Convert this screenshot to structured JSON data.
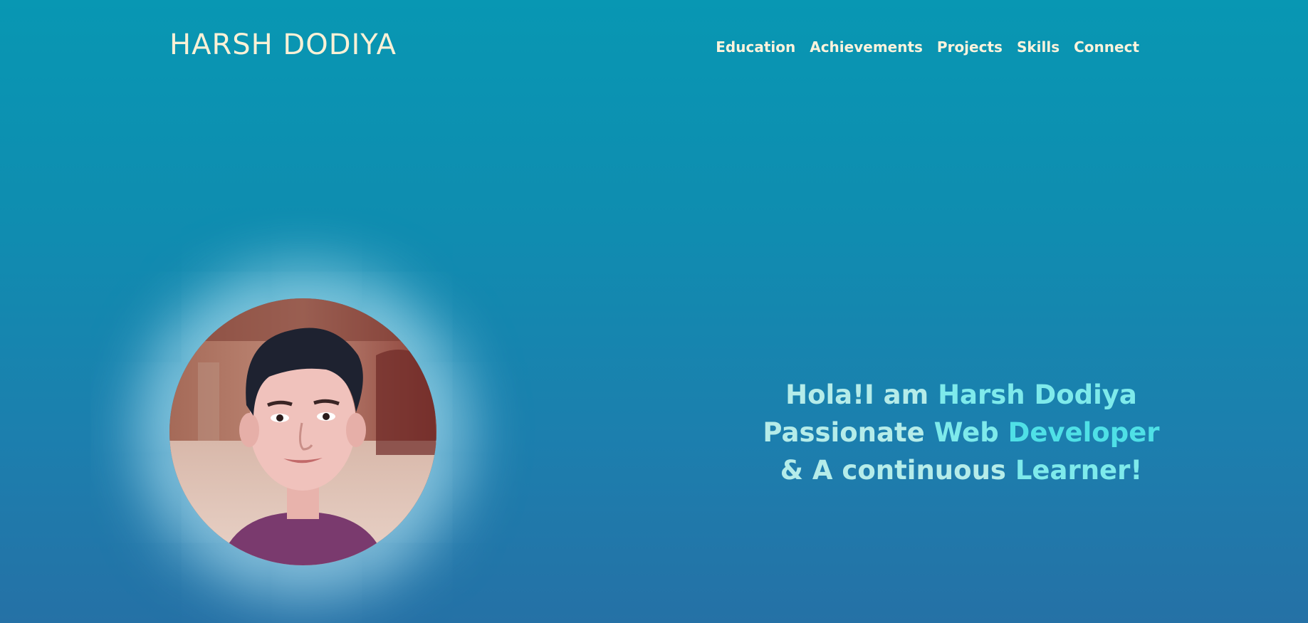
{
  "header": {
    "brand": "HARSH DODIYA",
    "nav": [
      {
        "label": "Education"
      },
      {
        "label": "Achievements"
      },
      {
        "label": "Projects"
      },
      {
        "label": "Skills"
      },
      {
        "label": "Connect"
      }
    ]
  },
  "hero": {
    "line1": {
      "part1": "Hola!I am ",
      "part2": "Harsh Dodiya"
    },
    "line2": {
      "part1": "Passionate ",
      "part2": "Web ",
      "part3": "Developer"
    },
    "line3": {
      "part1": "& A continuous ",
      "part2": "Learner!"
    }
  },
  "colors": {
    "background_top": "#0897b3",
    "background_bottom": "#2571a6",
    "brand_text": "#fbf1d6",
    "hero_light": "#b5ece9",
    "hero_accent": "#4fe0e6"
  }
}
